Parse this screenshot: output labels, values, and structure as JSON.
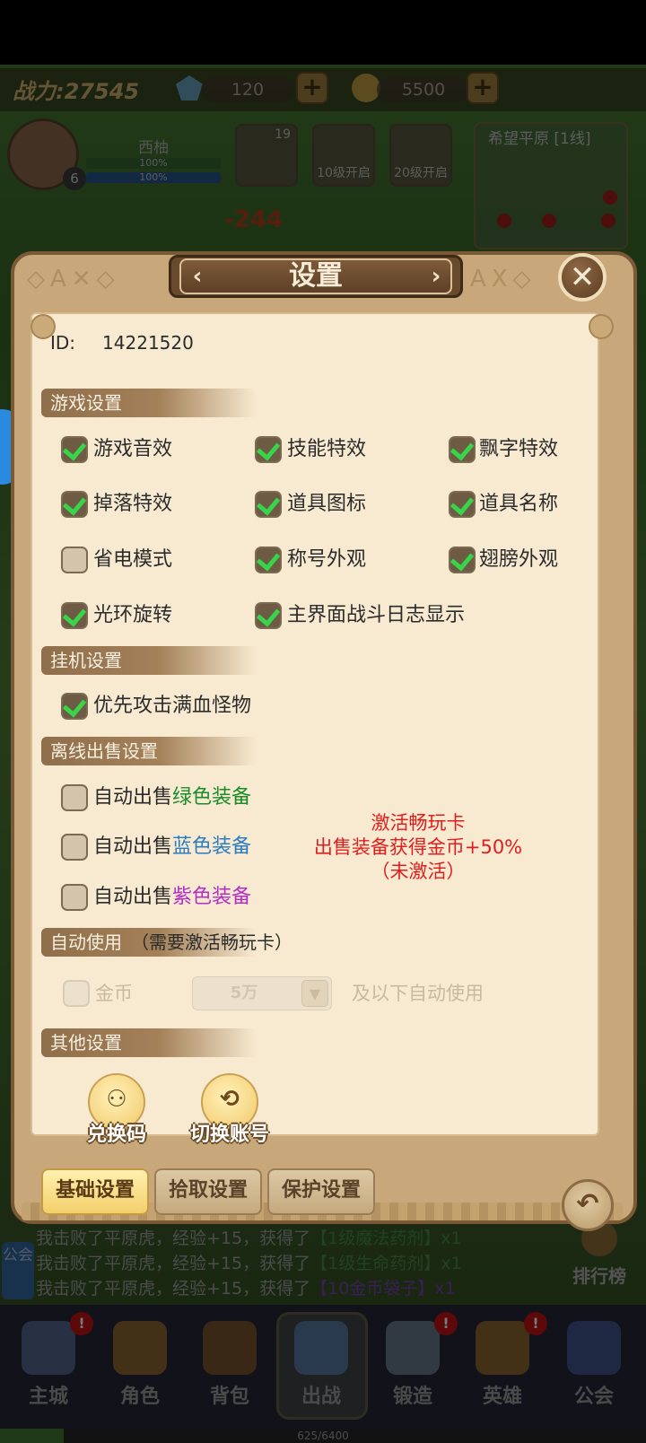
{
  "top_bar": {
    "power": "战力:27545",
    "gems": "120",
    "gold": "5500",
    "plus": "+"
  },
  "player": {
    "name": "西柚",
    "level": "6",
    "hp_text": "100%",
    "mp_text": "100%"
  },
  "hero_slots": [
    {
      "label": "19"
    },
    {
      "label": "10级开启"
    },
    {
      "label": "20级开启"
    }
  ],
  "map": {
    "title": "希望平原 [1线]"
  },
  "combat_damage": "-244",
  "dialog": {
    "title": "设置",
    "close": "✕",
    "id_label": "ID:",
    "id_value": "14221520",
    "sections": {
      "game": "游戏设置",
      "idle": "挂机设置",
      "offline_sell": "离线出售设置",
      "auto_use": "自动使用",
      "auto_use_note": "（需要激活畅玩卡）",
      "other": "其他设置"
    },
    "game_settings": [
      {
        "label": "游戏音效",
        "checked": true
      },
      {
        "label": "技能特效",
        "checked": true
      },
      {
        "label": "飘字特效",
        "checked": true
      },
      {
        "label": "掉落特效",
        "checked": true
      },
      {
        "label": "道具图标",
        "checked": true
      },
      {
        "label": "道具名称",
        "checked": true
      },
      {
        "label": "省电模式",
        "checked": false
      },
      {
        "label": "称号外观",
        "checked": true
      },
      {
        "label": "翅膀外观",
        "checked": true
      },
      {
        "label": "光环旋转",
        "checked": true
      },
      {
        "label": "主界面战斗日志显示",
        "checked": true
      }
    ],
    "idle_settings": [
      {
        "label": "优先攻击满血怪物",
        "checked": true
      }
    ],
    "offline_sell": {
      "prefix": "自动出售",
      "green": "绿色装备",
      "blue": "蓝色装备",
      "purple": "紫色装备",
      "colors": {
        "green": "#1a8c2a",
        "blue": "#2a7dc4",
        "purple": "#b32fc4"
      }
    },
    "promo": {
      "line1": "激活畅玩卡",
      "line2": "出售装备获得金币+50%",
      "line3": "（未激活）",
      "color": "#e01e1e"
    },
    "auto_use": {
      "item_label": "金币",
      "amount": "5万",
      "suffix": "及以下自动使用"
    },
    "other_buttons": {
      "redeem": "兑换码",
      "switch_account": "切换账号"
    },
    "tabs": [
      "基础设置",
      "拾取设置",
      "保护设置"
    ],
    "back": "↶"
  },
  "battle_log": [
    {
      "prefix": "我击败了平原虎，经验+15，获得了",
      "item": "【1级魔法药剂】",
      "suffix": "x1",
      "item_color": "green"
    },
    {
      "prefix": "我击败了平原虎，经验+15，获得了",
      "item": "【1级生命药剂】",
      "suffix": "x1",
      "item_color": "green"
    },
    {
      "prefix": "我击败了平原虎，经验+15，获得了",
      "item": "【10金币袋子】",
      "suffix": "x1",
      "item_color": "purple"
    }
  ],
  "guild_tab": "公会",
  "ranking": "排行榜",
  "bottom_nav": [
    {
      "label": "主城",
      "badge": "!"
    },
    {
      "label": "角色",
      "badge": ""
    },
    {
      "label": "背包",
      "badge": ""
    },
    {
      "label": "出战",
      "badge": ""
    },
    {
      "label": "锻造",
      "badge": "!"
    },
    {
      "label": "英雄",
      "badge": "!"
    },
    {
      "label": "公会",
      "badge": ""
    }
  ],
  "exp": {
    "text": "625/6400",
    "fraction": 0.098
  }
}
